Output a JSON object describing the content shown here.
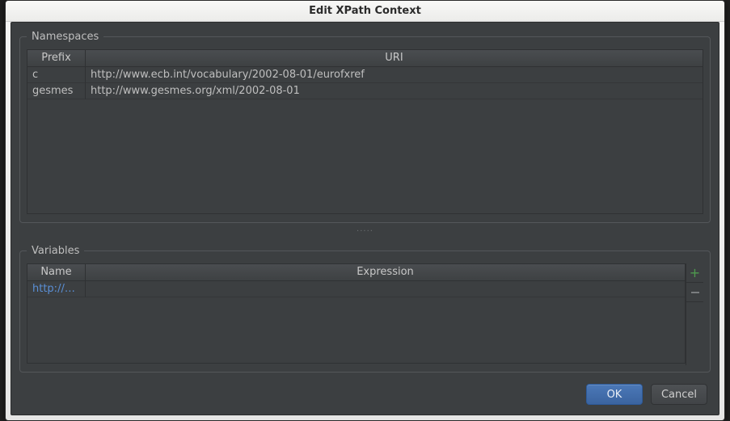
{
  "title": "Edit XPath Context",
  "namespaces": {
    "legend": "Namespaces",
    "columns": {
      "prefix": "Prefix",
      "uri": "URI"
    },
    "rows": [
      {
        "prefix": "c",
        "uri": "http://www.ecb.int/vocabulary/2002-08-01/eurofxref"
      },
      {
        "prefix": "gesmes",
        "uri": "http://www.gesmes.org/xml/2002-08-01"
      }
    ]
  },
  "variables": {
    "legend": "Variables",
    "columns": {
      "name": "Name",
      "expression": "Expression"
    },
    "rows": [
      {
        "name": "http://…",
        "expression": ""
      }
    ],
    "add_icon": "+",
    "remove_icon": "−"
  },
  "grip": "·····",
  "buttons": {
    "ok": "OK",
    "cancel": "Cancel"
  }
}
